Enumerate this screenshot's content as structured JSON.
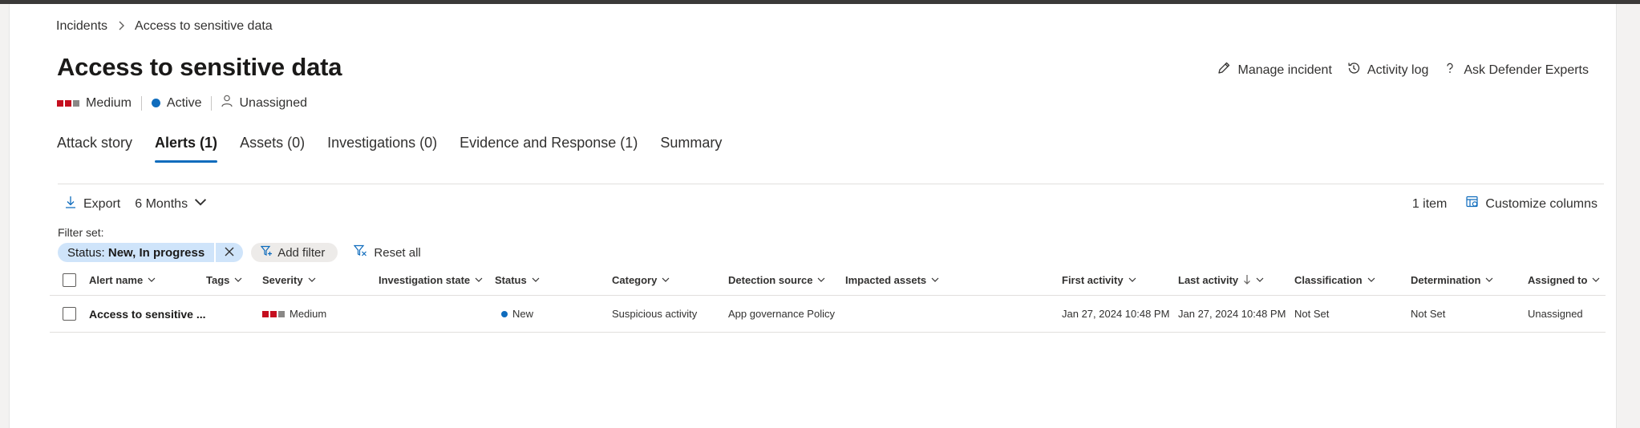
{
  "breadcrumb": {
    "parent": "Incidents",
    "current": "Access to sensitive data"
  },
  "title": "Access to sensitive data",
  "header_actions": {
    "manage_incident": "Manage incident",
    "activity_log": "Activity log",
    "ask_experts": "Ask Defender Experts"
  },
  "meta": {
    "severity": "Medium",
    "status": "Active",
    "assignee": "Unassigned",
    "severity_colors": [
      "#c50f1f",
      "#c50f1f",
      "#8a8886"
    ],
    "status_color": "#0f6cbd"
  },
  "tabs": [
    {
      "label": "Attack story",
      "active": false
    },
    {
      "label": "Alerts (1)",
      "active": true
    },
    {
      "label": "Assets (0)",
      "active": false
    },
    {
      "label": "Investigations (0)",
      "active": false
    },
    {
      "label": "Evidence and Response (1)",
      "active": false
    },
    {
      "label": "Summary",
      "active": false
    }
  ],
  "toolbar": {
    "export": "Export",
    "time_range": "6 Months",
    "item_count": "1 item",
    "customize_columns": "Customize columns"
  },
  "filters": {
    "label": "Filter set:",
    "chip_key": "Status:",
    "chip_value": "New, In progress",
    "add_filter": "Add filter",
    "reset_all": "Reset all"
  },
  "table": {
    "columns": [
      "Alert name",
      "Tags",
      "Severity",
      "Investigation state",
      "Status",
      "Category",
      "Detection source",
      "Impacted assets",
      "First activity",
      "Last activity",
      "Classification",
      "Determination",
      "Assigned to"
    ],
    "rows": [
      {
        "alert_name": "Access to sensitive ...",
        "tags": "",
        "severity": "Medium",
        "investigation_state": "",
        "status": "New",
        "category": "Suspicious activity",
        "detection_source": "App governance Policy",
        "impacted_assets": "",
        "first_activity": "Jan 27, 2024 10:48 PM",
        "last_activity": "Jan 27, 2024 10:48 PM",
        "classification": "Not Set",
        "determination": "Not Set",
        "assigned_to": "Unassigned"
      }
    ]
  }
}
